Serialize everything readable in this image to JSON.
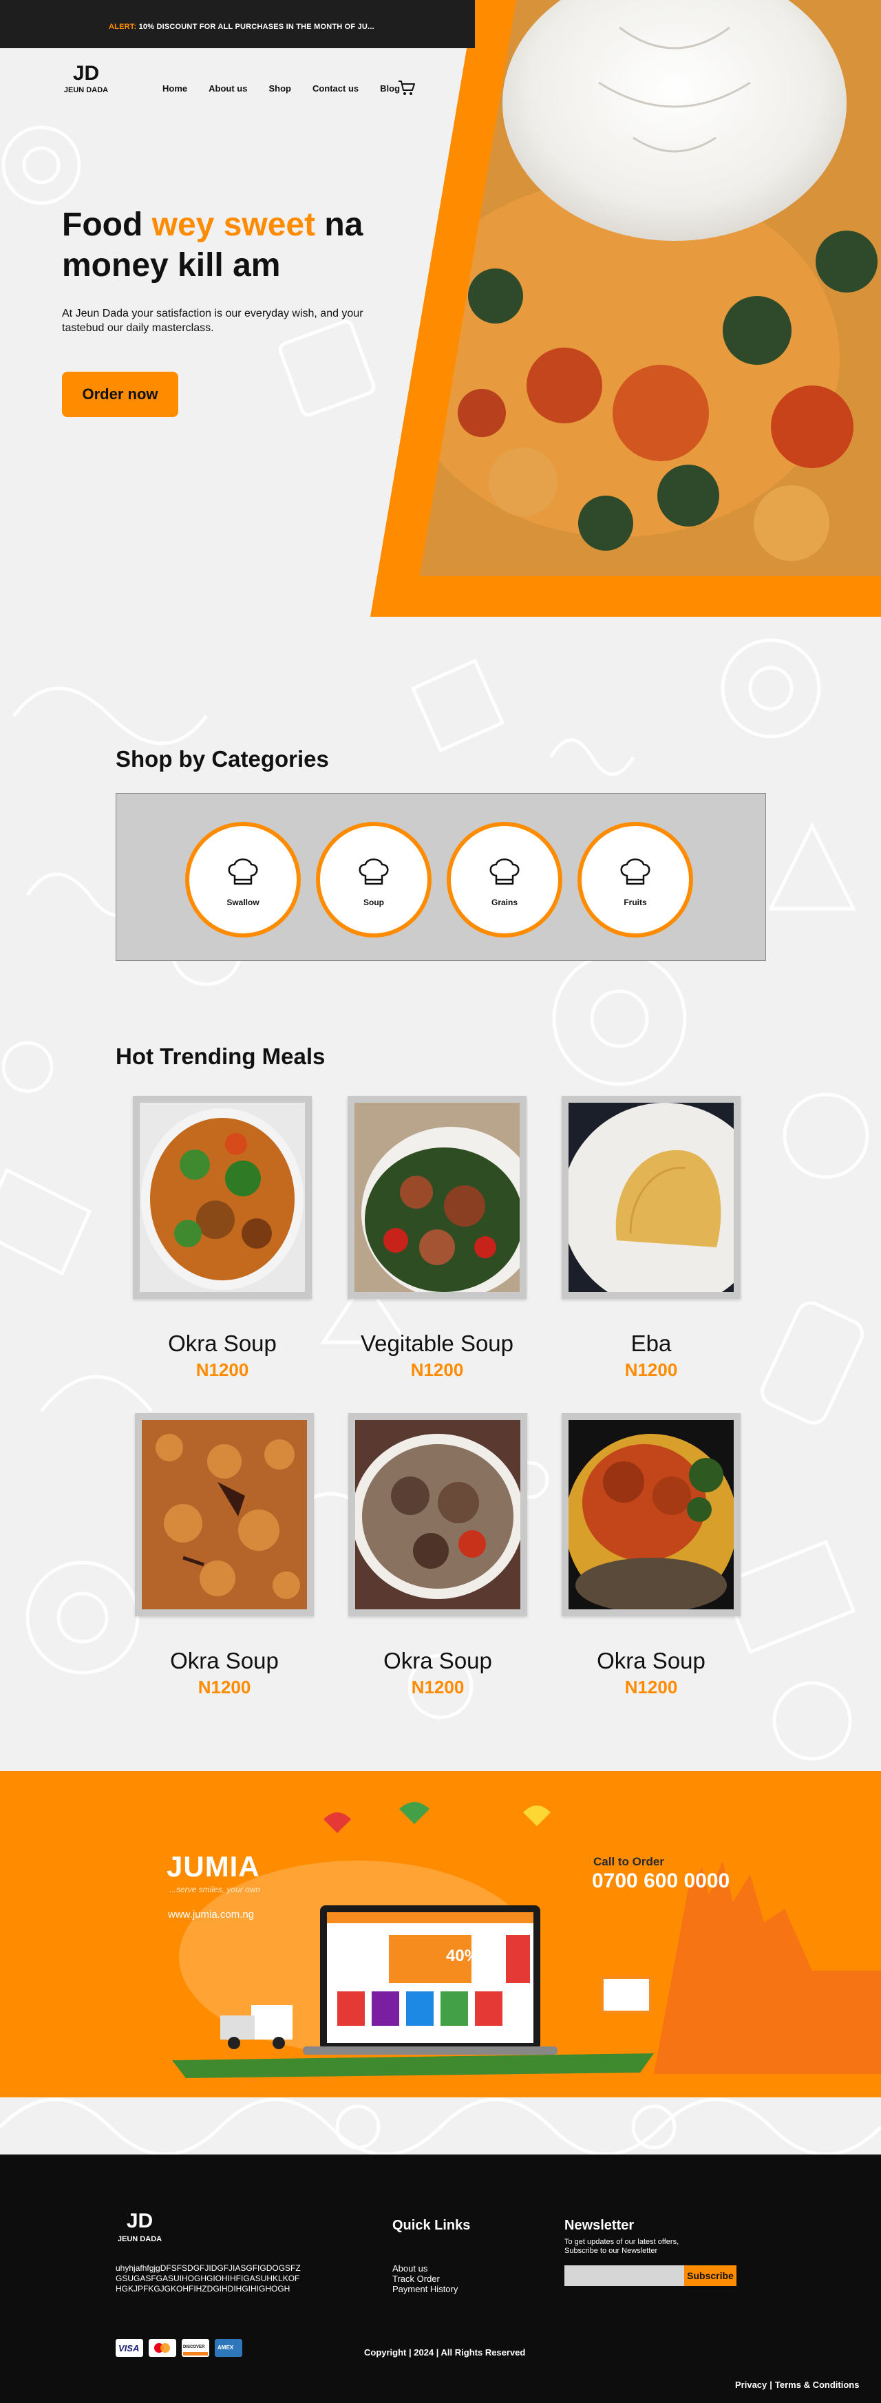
{
  "alert": {
    "label": "ALERT:",
    "text": "10% DISCOUNT FOR ALL PURCHASES IN THE MONTH OF JU..."
  },
  "brand": {
    "mark": "JD",
    "name": "JEUN DADA"
  },
  "nav": {
    "items": [
      "Home",
      "About us",
      "Shop",
      "Contact us",
      "Blog"
    ]
  },
  "hero": {
    "title_part1": "Food ",
    "title_accent": "wey sweet",
    "title_part2": " na money kill am",
    "subtitle": "At Jeun Dada your satisfaction is our everyday wish, and your tastebud our daily masterclass.",
    "cta": "Order now"
  },
  "categories": {
    "title": "Shop by Categories",
    "items": [
      {
        "label": "Swallow",
        "icon": "chef-hat-icon"
      },
      {
        "label": "Soup",
        "icon": "chef-hat-icon"
      },
      {
        "label": "Grains",
        "icon": "chef-hat-icon"
      },
      {
        "label": "Fruits",
        "icon": "chef-hat-icon"
      }
    ]
  },
  "meals": {
    "title": "Hot Trending Meals",
    "items": [
      {
        "name": "Okra Soup",
        "price": "N1200"
      },
      {
        "name": "Vegitable Soup",
        "price": "N1200"
      },
      {
        "name": "Eba",
        "price": "N1200"
      },
      {
        "name": "Okra Soup",
        "price": "N1200"
      },
      {
        "name": "Okra Soup",
        "price": "N1200"
      },
      {
        "name": "Okra Soup",
        "price": "N1200"
      }
    ]
  },
  "banner": {
    "brand": "JUMIA",
    "tagline": "...serve smiles, your own",
    "url": "www.jumia.com.ng",
    "call_label": "Call to Order",
    "phone": "0700 600 0000",
    "discount": "40%"
  },
  "footer": {
    "about": "uhyhjafhfgjgDFSFSDGFJIDGFJIASGFIGDOGSFZGSUGASFGASUIHOGHGIOHIHFIGASUHKLKOFHGKJPFKGJGKOHFIHZDGIHDIHGIHIGHOGH",
    "quick_links_title": "Quick Links",
    "quick_links": [
      "About us",
      "Track Order",
      "Payment History"
    ],
    "newsletter_title": "Newsletter",
    "newsletter_text": "To get updates of our latest offers, Subscribe to our Newsletter",
    "newsletter_placeholder": "",
    "subscribe": "Subscribe",
    "payments": [
      "VISA",
      "mastercard",
      "DISCOVER",
      "AMEX"
    ],
    "copyright": "Copyright | 2024 | All Rights Reserved",
    "privacy": "Privacy",
    "terms": "Terms & Conditions"
  },
  "colors": {
    "accent": "#ff8c00",
    "dark": "#1e1e1e",
    "footer": "#0d0d0d",
    "panel": "#cccccc"
  }
}
